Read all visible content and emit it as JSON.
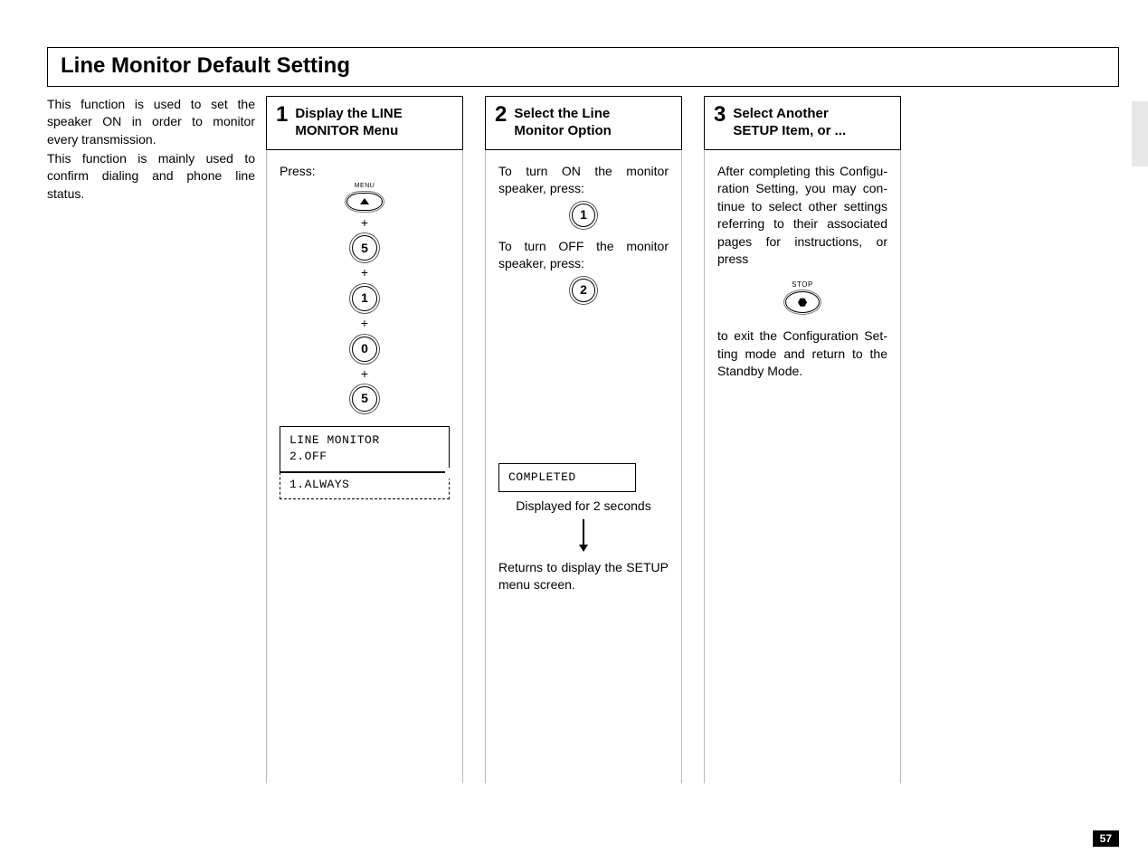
{
  "page_number": "57",
  "title": "Line Monitor Default Setting",
  "intro": {
    "p1": "This function is used to set the speaker ON in order to monitor every transmission.",
    "p2": "This function is mainly used to confirm dialing and phone line status."
  },
  "steps": {
    "s1": {
      "num": "1",
      "title_l1": "Display the LINE",
      "title_l2": "MONITOR Menu",
      "press_label": "Press:",
      "menu_label": "MENU",
      "keys": [
        "5",
        "1",
        "0",
        "5"
      ],
      "lcd_l1": "LINE MONITOR",
      "lcd_l2": "2.OFF",
      "lcd_l3": "1.ALWAYS"
    },
    "s2": {
      "num": "2",
      "title_l1": "Select the Line",
      "title_l2": "Monitor Option",
      "on_text": "To turn ON the monitor speaker, press:",
      "on_key": "1",
      "off_text": "To turn OFF the monitor speaker, press:",
      "off_key": "2",
      "lcd": "COMPLETED",
      "caption_2s": "Displayed for 2 seconds",
      "returns": "Returns to display the SETUP menu screen."
    },
    "s3": {
      "num": "3",
      "title_l1": "Select Another",
      "title_l2": "SETUP Item, or ...",
      "para1": "After completing this Configu­ration Setting, you may con­tinue to select other settings referring to their associated pages for instructions, or press",
      "stop_label": "STOP",
      "para2": "to exit the Configuration Set­ting mode and return to the Standby Mode."
    }
  }
}
